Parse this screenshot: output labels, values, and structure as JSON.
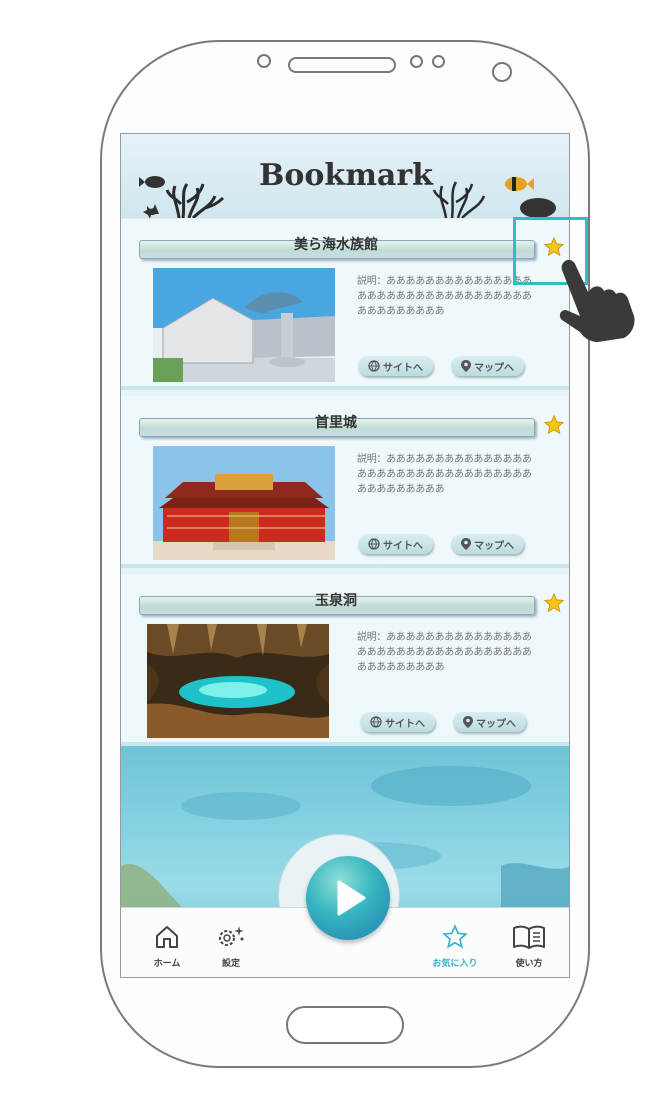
{
  "header": {
    "title": "Bookmark"
  },
  "cards": [
    {
      "title": "美ら海水族館",
      "description": "説明：ああああああああああああああああああああああああああああああああああああああああああ",
      "site_label": "サイトへ",
      "map_label": "マップへ"
    },
    {
      "title": "首里城",
      "description": "説明：ああああああああああああああああああああああああああああああああああああああああああ",
      "site_label": "サイトへ",
      "map_label": "マップへ"
    },
    {
      "title": "玉泉洞",
      "description": "説明：ああああああああああああああああああああああああああああああああああああああああああ",
      "site_label": "サイトへ",
      "map_label": "マップへ"
    }
  ],
  "nav": {
    "home_label": "ホーム",
    "settings_label": "設定",
    "favorites_label": "お気に入り",
    "howto_label": "使い方",
    "active_item": "favorites"
  },
  "colors": {
    "accent": "#3bb0c8",
    "star": "#f5c518",
    "highlight": "#2ebfc4"
  },
  "icons": {
    "star": "star-icon",
    "play": "play-icon",
    "globe": "globe-icon",
    "map_pin": "map-pin-icon",
    "hand": "pointing-hand-icon"
  }
}
